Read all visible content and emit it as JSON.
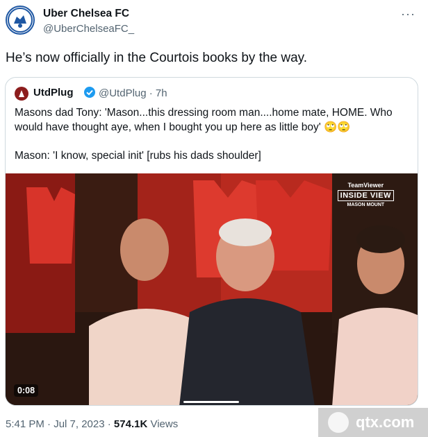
{
  "tweet": {
    "display_name": "Uber Chelsea FC",
    "handle": "@UberChelseaFC_",
    "text": "He’s now officially in the Courtois books by the way.",
    "more_icon": "more-icon",
    "time": "5:41 PM · Jul 7, 2023 · ",
    "views_count": "574.1K",
    "views_label": " Views"
  },
  "quote": {
    "name": "UtdPlug",
    "handle_time": "@UtdPlug · 7h",
    "text_line1": "Masons dad Tony: 'Mason...this dressing room man....home mate, HOME. Who would have thought aye, when I bought you up here as little boy' 🙄🙄",
    "text_line2": "Mason: 'I know, special init' [rubs his dads shoulder]",
    "video": {
      "timestamp": "0:08",
      "brand_line1": "TeamViewer",
      "brand_line2": "INSIDE VIEW",
      "brand_line3": "MASON MOUNT",
      "progress": 0.2
    }
  },
  "watermark": {
    "text": "qtx.com"
  },
  "colors": {
    "text": "#0f1419",
    "muted": "#536471",
    "border": "#cfd9de",
    "verified": "#1d9bf0"
  }
}
